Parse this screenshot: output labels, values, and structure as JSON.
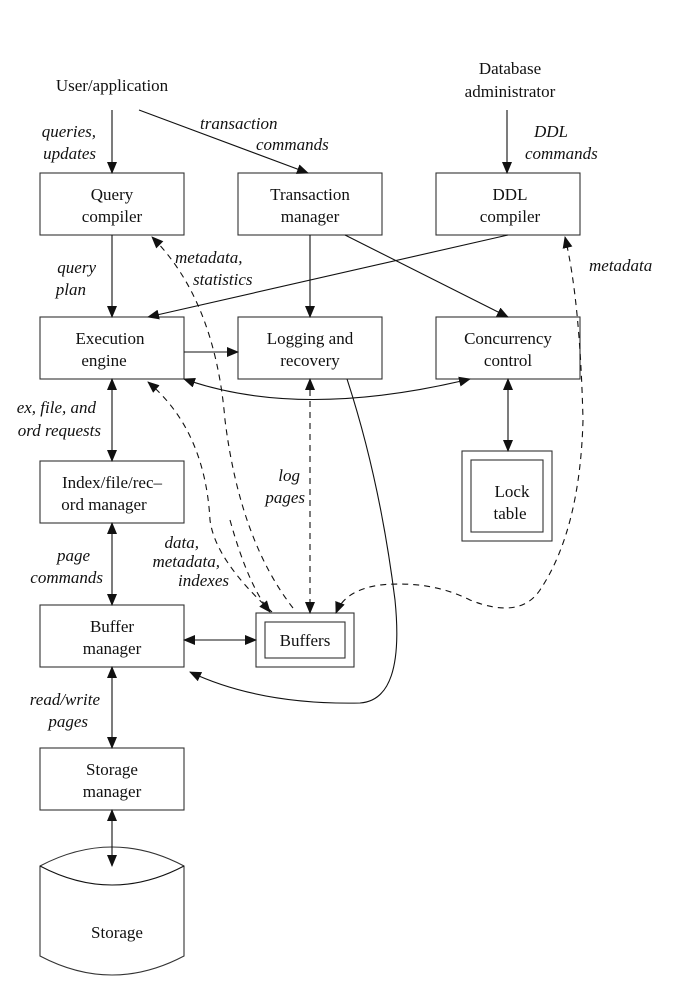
{
  "actors": {
    "user": "User/application",
    "dba_line1": "Database",
    "dba_line2": "administrator"
  },
  "components": [
    {
      "id": "query-compiler",
      "lines": [
        "Query",
        "compiler"
      ]
    },
    {
      "id": "transaction-manager",
      "lines": [
        "Transaction",
        "manager"
      ]
    },
    {
      "id": "ddl-compiler",
      "lines": [
        "DDL",
        "compiler"
      ]
    },
    {
      "id": "execution-engine",
      "lines": [
        "Execution",
        "engine"
      ]
    },
    {
      "id": "logging-recovery",
      "lines": [
        "Logging and",
        "recovery"
      ]
    },
    {
      "id": "concurrency-control",
      "lines": [
        "Concurrency",
        "control"
      ]
    },
    {
      "id": "index-file-record-manager",
      "lines": [
        "Index/file/rec–",
        "ord manager"
      ]
    },
    {
      "id": "buffer-manager",
      "lines": [
        "Buffer",
        "manager"
      ]
    },
    {
      "id": "storage-manager",
      "lines": [
        "Storage",
        "manager"
      ]
    }
  ],
  "stores": {
    "lock_table": [
      "Lock",
      "table"
    ],
    "buffers": "Buffers",
    "storage": "Storage"
  },
  "edge_labels": {
    "queries_updates": [
      "queries,",
      "updates"
    ],
    "transaction_commands": [
      "transaction",
      "commands"
    ],
    "ddl_commands": [
      "DDL",
      "commands"
    ],
    "query_plan": [
      "query",
      "plan"
    ],
    "metadata_statistics": [
      "metadata,",
      "statistics"
    ],
    "metadata": "metadata",
    "index_file_record_requests": [
      "ex, file, and",
      "ord requests"
    ],
    "log_pages": [
      "log",
      "pages"
    ],
    "page_commands": [
      "page",
      "commands"
    ],
    "data_metadata_indexes": [
      "data,",
      "metadata,",
      "indexes"
    ],
    "read_write_pages": [
      "read/write",
      "pages"
    ]
  }
}
